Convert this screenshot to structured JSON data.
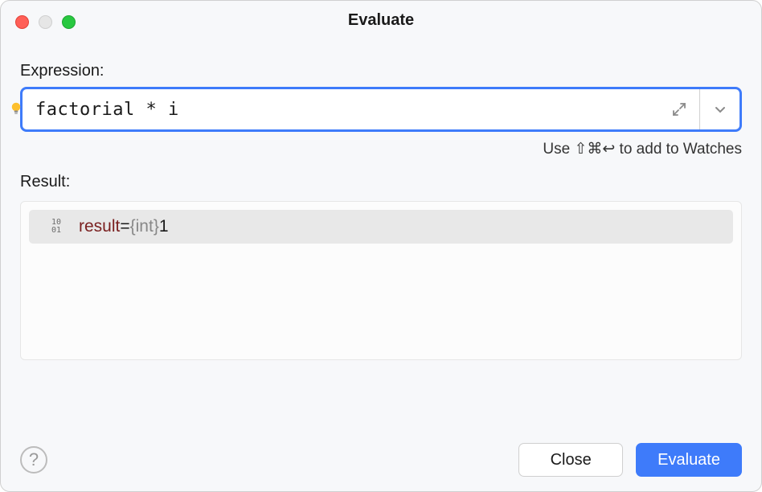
{
  "window": {
    "title": "Evaluate"
  },
  "expression": {
    "label": "Expression:",
    "value": "factorial * i"
  },
  "hint": "Use ⇧⌘↩ to add to Watches",
  "result": {
    "label": "Result:",
    "name": "result",
    "equals": " = ",
    "type": "{int} ",
    "value": "1"
  },
  "buttons": {
    "close": "Close",
    "evaluate": "Evaluate",
    "help": "?"
  }
}
